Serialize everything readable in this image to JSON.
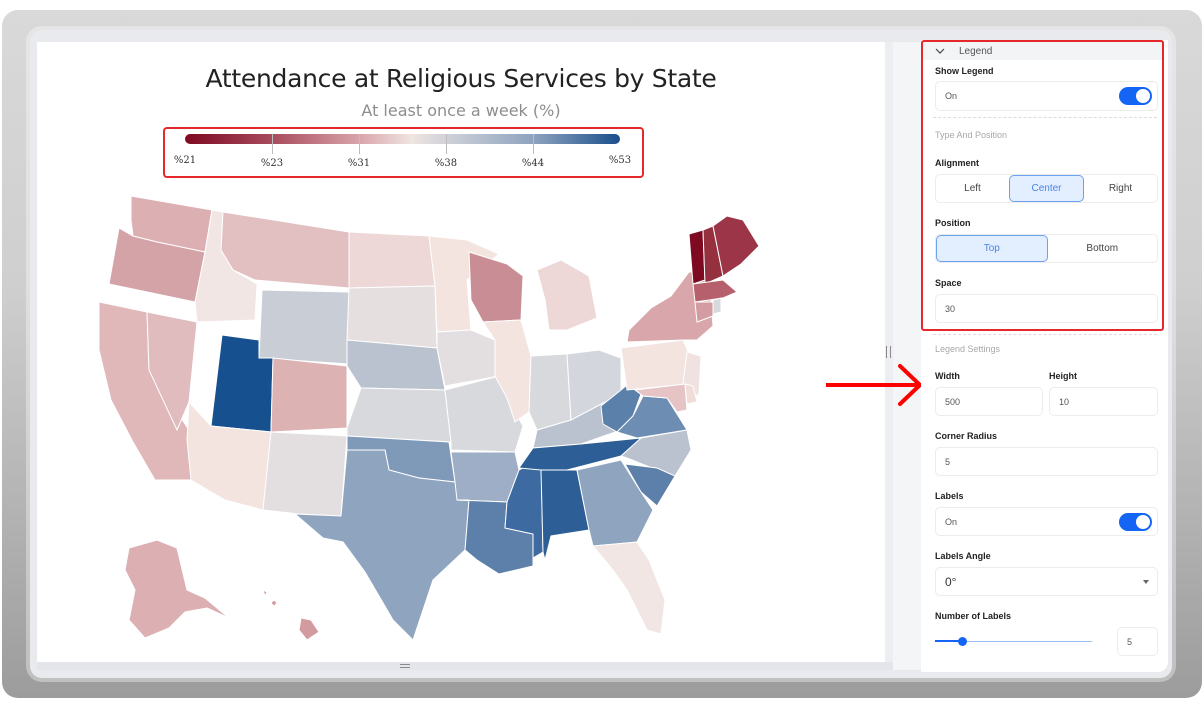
{
  "chart": {
    "title": "Attendance at Religious Services by State",
    "subtitle": "At least once a week (%)"
  },
  "chart_data": {
    "type": "choropleth-map",
    "title": "Attendance at Religious Services by State",
    "subtitle": "At least once a week (%)",
    "legend": {
      "type": "gradient",
      "position": "top-center",
      "min": 21,
      "max": 53,
      "tick_labels": [
        "%21",
        "%23",
        "%31",
        "%38",
        "%44",
        "%53"
      ],
      "colors": [
        "#7e0a22",
        "#a84b5c",
        "#d9a4ab",
        "#efe4e1",
        "#c9cdd6",
        "#8ea3bf",
        "#1a4f8c"
      ]
    },
    "states": [
      {
        "id": "WA",
        "value": 29,
        "color": "#dcb0b3"
      },
      {
        "id": "OR",
        "value": 26,
        "color": "#d4a3a8"
      },
      {
        "id": "CA",
        "value": 30,
        "color": "#e0b8ba"
      },
      {
        "id": "NV",
        "value": 30,
        "color": "#e1bcbe"
      },
      {
        "id": "ID",
        "value": 34,
        "color": "#f1e6e3"
      },
      {
        "id": "MT",
        "value": 30,
        "color": "#e2bfc0"
      },
      {
        "id": "WY",
        "value": 38,
        "color": "#c9cdd6"
      },
      {
        "id": "UT",
        "value": 53,
        "color": "#17508e"
      },
      {
        "id": "AZ",
        "value": 34,
        "color": "#f3e4df"
      },
      {
        "id": "CO",
        "value": 29,
        "color": "#dcb2b3"
      },
      {
        "id": "NM",
        "value": 36,
        "color": "#e3dfe0"
      },
      {
        "id": "ND",
        "value": 32,
        "color": "#eed8d7"
      },
      {
        "id": "SD",
        "value": 36,
        "color": "#e6dfdf"
      },
      {
        "id": "NE",
        "value": 39,
        "color": "#bac2cf"
      },
      {
        "id": "KS",
        "value": 37,
        "color": "#d8d9dd"
      },
      {
        "id": "OK",
        "value": 45,
        "color": "#7f99b9"
      },
      {
        "id": "TX",
        "value": 43,
        "color": "#8fa5bf"
      },
      {
        "id": "MN",
        "value": 33,
        "color": "#f3e4df"
      },
      {
        "id": "IA",
        "value": 36,
        "color": "#e3dfe0"
      },
      {
        "id": "MO",
        "value": 37,
        "color": "#d8d9dd"
      },
      {
        "id": "AR",
        "value": 42,
        "color": "#9eaec6"
      },
      {
        "id": "LA",
        "value": 47,
        "color": "#5d80aa"
      },
      {
        "id": "WI",
        "value": 27,
        "color": "#c98d95"
      },
      {
        "id": "IL",
        "value": 34,
        "color": "#f3e4df"
      },
      {
        "id": "MS",
        "value": 50,
        "color": "#3d6aa0"
      },
      {
        "id": "MI",
        "value": 32,
        "color": "#eed8d7"
      },
      {
        "id": "IN",
        "value": 37,
        "color": "#d8d9dd"
      },
      {
        "id": "KY",
        "value": 40,
        "color": "#bac2cf"
      },
      {
        "id": "TN",
        "value": 52,
        "color": "#2d5f96"
      },
      {
        "id": "AL",
        "value": 52,
        "color": "#2d5f96"
      },
      {
        "id": "OH",
        "value": 37,
        "color": "#d3d6dc"
      },
      {
        "id": "WV",
        "value": 47,
        "color": "#5b80aa"
      },
      {
        "id": "VA",
        "value": 45,
        "color": "#6d8db3"
      },
      {
        "id": "NC",
        "value": 40,
        "color": "#bac2cf"
      },
      {
        "id": "SC",
        "value": 47,
        "color": "#5d80aa"
      },
      {
        "id": "GA",
        "value": 43,
        "color": "#8fa5bf"
      },
      {
        "id": "FL",
        "value": 34,
        "color": "#f1e6e3"
      },
      {
        "id": "PA",
        "value": 33,
        "color": "#f3e4df"
      },
      {
        "id": "NY",
        "value": 28,
        "color": "#d9a7ab"
      },
      {
        "id": "NJ",
        "value": 34,
        "color": "#f0e2e0"
      },
      {
        "id": "MD",
        "value": 30,
        "color": "#e6c4c6"
      },
      {
        "id": "DE",
        "value": 32,
        "color": "#f0dcd9"
      },
      {
        "id": "VT",
        "value": 21,
        "color": "#7e0a22"
      },
      {
        "id": "NH",
        "value": 22,
        "color": "#95303f"
      },
      {
        "id": "ME",
        "value": 22,
        "color": "#9b3547"
      },
      {
        "id": "MA",
        "value": 25,
        "color": "#b5606c"
      },
      {
        "id": "CT",
        "value": 27,
        "color": "#d29ca2"
      },
      {
        "id": "RI",
        "value": 37,
        "color": "#d8d9dd"
      },
      {
        "id": "AK",
        "value": 29,
        "color": "#dcb0b3"
      },
      {
        "id": "HI",
        "value": 28,
        "color": "#d39a9f"
      }
    ]
  },
  "settings": {
    "section_title": "Legend",
    "show_legend": {
      "label": "Show Legend",
      "value": "On",
      "enabled": true
    },
    "type_and_position_heading": "Type And Position",
    "alignment": {
      "label": "Alignment",
      "options": [
        "Left",
        "Center",
        "Right"
      ],
      "selected": "Center"
    },
    "position": {
      "label": "Position",
      "options": [
        "Top",
        "Bottom"
      ],
      "selected": "Top"
    },
    "space": {
      "label": "Space",
      "value": "30"
    },
    "legend_settings_heading": "Legend Settings",
    "width": {
      "label": "Width",
      "value": "500"
    },
    "height": {
      "label": "Height",
      "value": "10"
    },
    "corner_radius": {
      "label": "Corner Radius",
      "value": "5"
    },
    "labels": {
      "label": "Labels",
      "value": "On",
      "enabled": true
    },
    "labels_angle": {
      "label": "Labels Angle",
      "value": "0°"
    },
    "number_of_labels": {
      "label": "Number of Labels",
      "value": "5",
      "slider_fraction": 0.17
    }
  },
  "colors": {
    "accent": "#1565f5",
    "annotation_red": "#e5282b"
  }
}
